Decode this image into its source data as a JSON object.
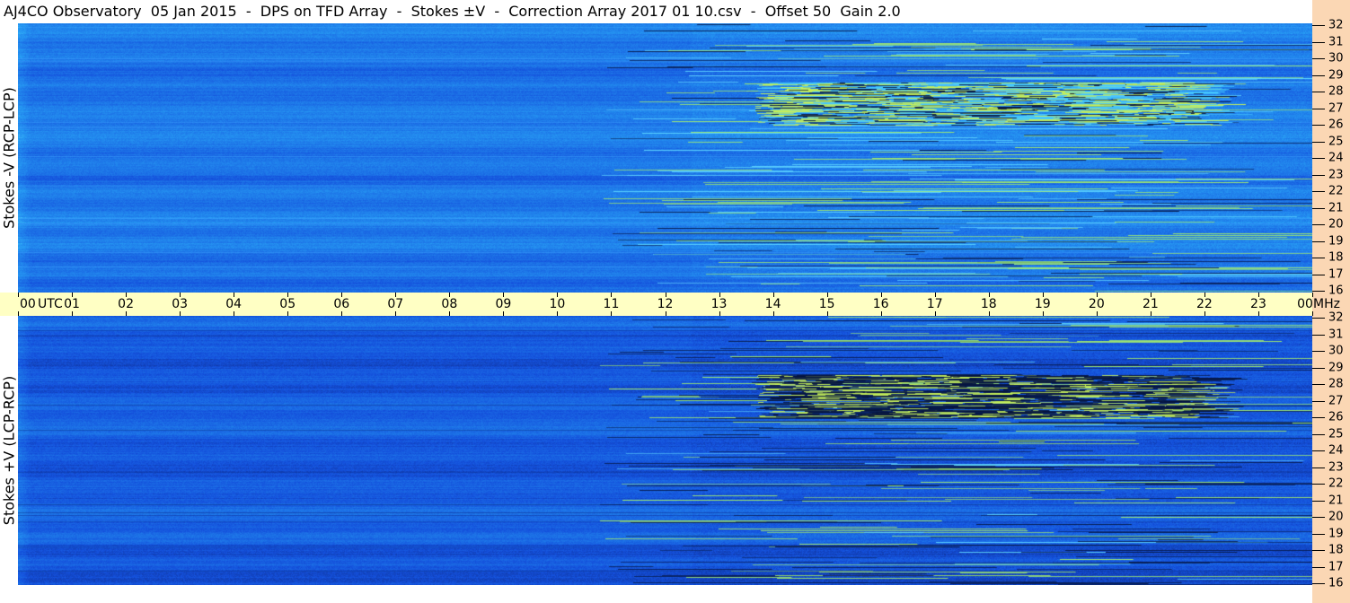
{
  "header": {
    "title": "AJ4CO Observatory  05 Jan 2015  -  DPS on TFD Array  -  Stokes ±V  -  Correction Array 2017 01 10.csv  -  Offset 50  Gain 2.0"
  },
  "top_panel": {
    "ylabel": "Stokes -V (RCP-LCP)",
    "freq_labels": [
      "32",
      "31",
      "30",
      "29",
      "28",
      "27",
      "26",
      "25",
      "24",
      "23",
      "22",
      "21",
      "20",
      "19",
      "18",
      "17",
      "16"
    ]
  },
  "bottom_panel": {
    "ylabel": "Stokes +V (LCP-RCP)",
    "freq_labels": [
      "32",
      "31",
      "30",
      "29",
      "28",
      "27",
      "26",
      "25",
      "24",
      "23",
      "22",
      "21",
      "20",
      "19",
      "18",
      "17",
      "16"
    ]
  },
  "time_axis": {
    "labels": [
      "00",
      "01",
      "02",
      "03",
      "04",
      "05",
      "06",
      "07",
      "08",
      "09",
      "10",
      "11",
      "12",
      "13",
      "14",
      "15",
      "16",
      "17",
      "18",
      "19",
      "20",
      "21",
      "22",
      "23",
      "00"
    ],
    "utc_label": "UTC",
    "unit_label": "MHz"
  },
  "colors": {
    "top_base": "#1f7be6",
    "bottom_base": "#1458d8",
    "timebar": "#ffffc4",
    "right_strip": "#fbd7b4"
  }
}
